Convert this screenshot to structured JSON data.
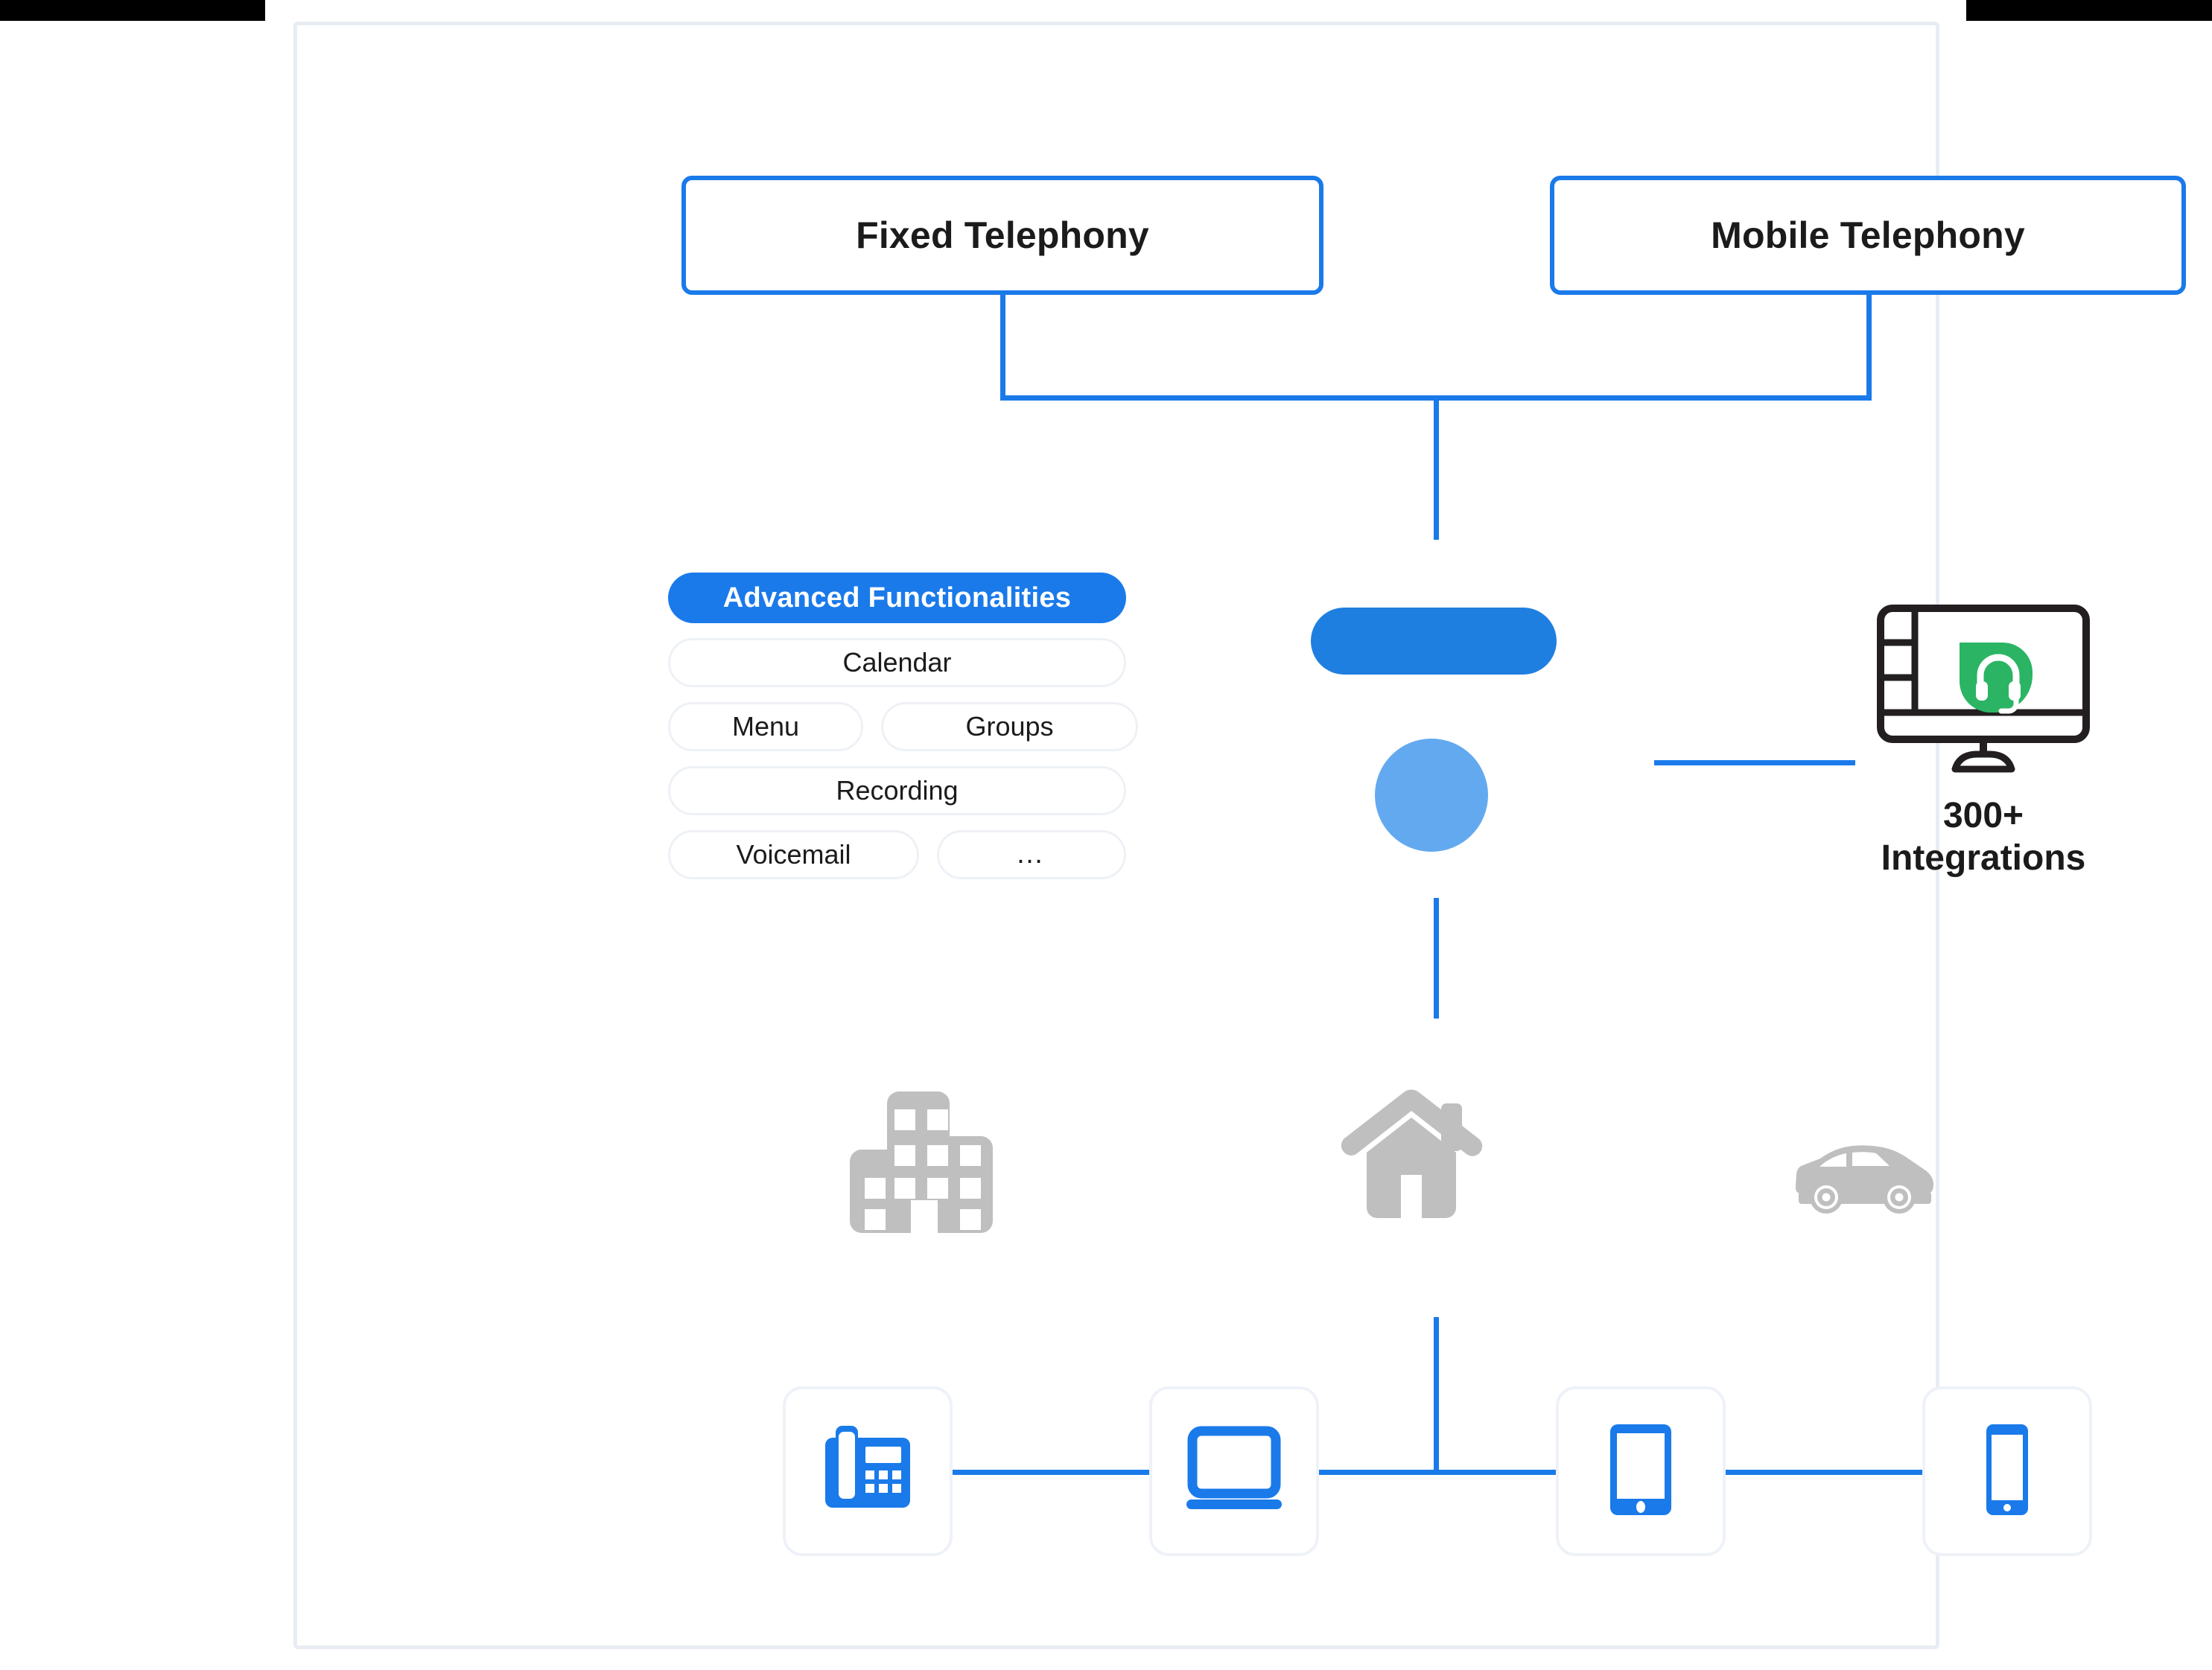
{
  "diagram": {
    "title_nodes": {
      "fixed_telephony": "Fixed Telephony",
      "mobile_telephony": "Mobile Telephony"
    },
    "advanced_functionalities": {
      "header": "Advanced Functionalities",
      "rows": [
        [
          {
            "label": "Calendar"
          }
        ],
        [
          {
            "label": "Menu"
          },
          {
            "label": "Groups"
          }
        ],
        [
          {
            "label": "Recording"
          }
        ],
        [
          {
            "label": "Voicemail"
          },
          {
            "label": "…",
            "is_more": true
          }
        ]
      ]
    },
    "integrations": {
      "count_label": "300+",
      "name_label": "Integrations",
      "icon": "monitor-headset-icon",
      "badge_color": "#2bb464"
    },
    "brand_logo": {
      "icon": "brand-logo-mark",
      "bar_color": "#1f7fe0",
      "dot_color": "#63a9ef"
    },
    "locations": [
      {
        "icon": "office-building-icon",
        "color": "#bfbfbf"
      },
      {
        "icon": "house-icon",
        "color": "#bfbfbf"
      },
      {
        "icon": "car-icon",
        "color": "#bfbfbf"
      }
    ],
    "devices": [
      {
        "icon": "desk-phone-icon"
      },
      {
        "icon": "laptop-icon"
      },
      {
        "icon": "tablet-icon"
      },
      {
        "icon": "smartphone-icon"
      }
    ],
    "colors": {
      "accent_blue": "#1a7aea",
      "line_blue": "#1a7aea",
      "frame_border": "#e8edf3",
      "pill_border": "#eef1f6",
      "grey_icon": "#bfbfbf"
    }
  }
}
